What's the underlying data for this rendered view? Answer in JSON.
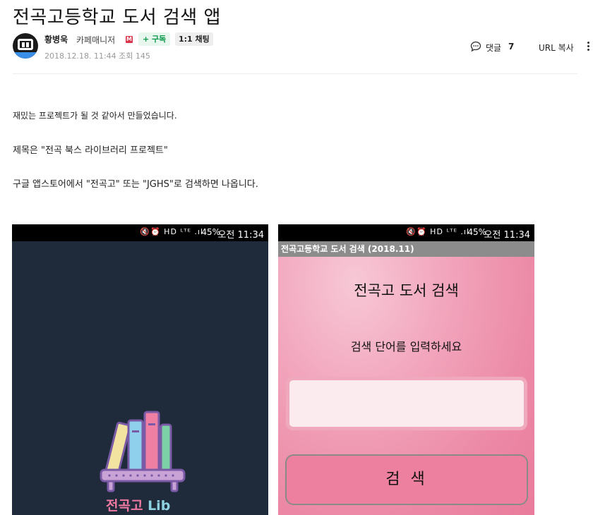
{
  "post": {
    "title": "전곡고등학교 도서 검색 앱",
    "author_name": "황병욱",
    "author_role": "카페매니저",
    "role_badge": "M",
    "subscribe_label": "+ 구독",
    "chat_label": "1:1 채팅",
    "meta": "2018.12.18. 11:44  조회 145",
    "comment_label": "댓글",
    "comment_count": "7",
    "url_copy_label": "URL 복사"
  },
  "body": {
    "p1": "재밌는 프로젝트가 될 것 같아서 만들었습니다.",
    "p2": "제목은 \"전곡 북스 라이브러리 프로젝트\"",
    "p3": "구글 앱스토어에서 \"전곡고\" 또는 \"JGHS\"로 검색하면 나옵니다."
  },
  "screenshots": [
    {
      "status_battery": "45%",
      "status_time": "오전 11:34",
      "splash_word1": "전곡고",
      "splash_word2": "Lib"
    },
    {
      "status_battery": "45%",
      "status_time": "오전 11:34",
      "app_bar_title": "전곡고등학교 도서 검색 (2018.11)",
      "heading": "전곡고 도서 검색",
      "prompt": "검색 단어를 입력하세요",
      "search_value": "",
      "search_button": "검 색"
    }
  ],
  "colors": {
    "splash_bg": "#1f2a3a",
    "search_bg": "#ee8aa6",
    "subscribe": "#0b9a4b",
    "badge": "#d9364c"
  }
}
